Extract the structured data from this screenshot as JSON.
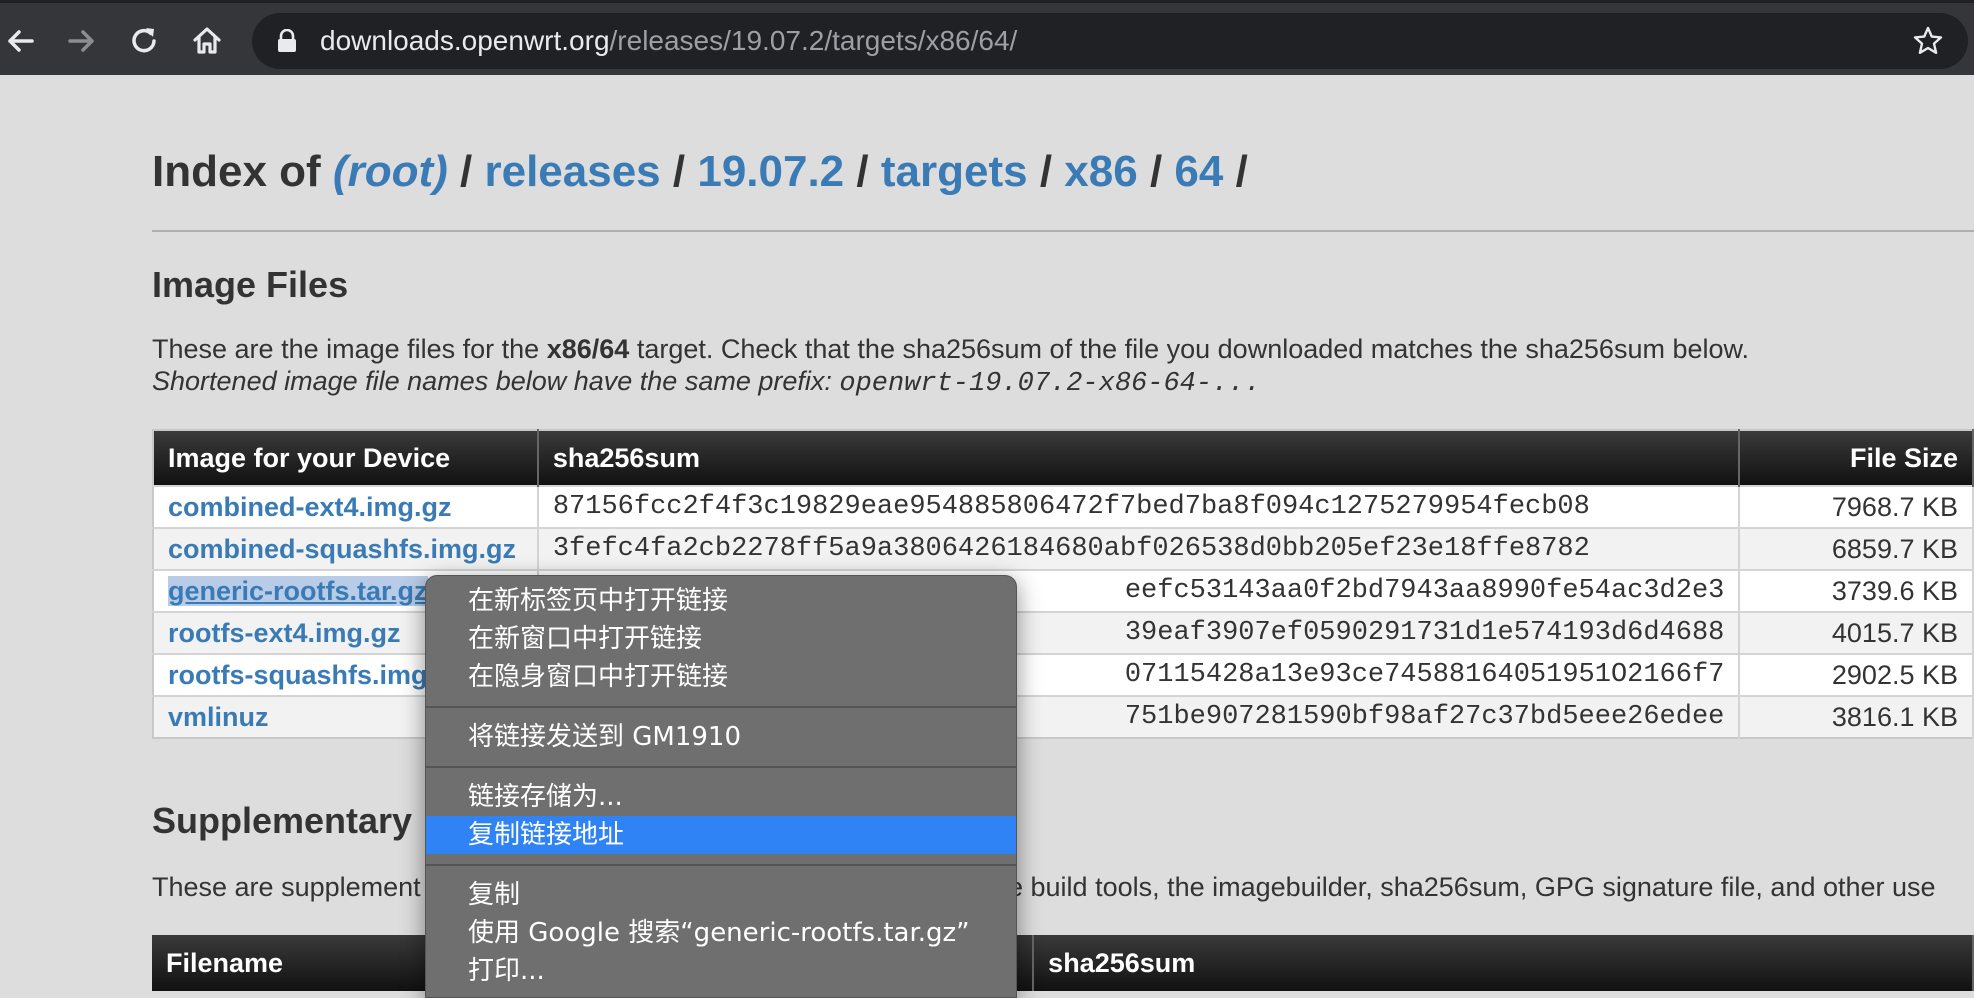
{
  "browser": {
    "url_host": "downloads.openwrt.org",
    "url_path": "/releases/19.07.2/targets/x86/64/"
  },
  "page": {
    "title_prefix": "Index of",
    "breadcrumb": [
      "(root)",
      "releases",
      "19.07.2",
      "targets",
      "x86",
      "64"
    ],
    "image_files_heading": "Image Files",
    "desc_line1_a": "These are the image files for the ",
    "desc_line1_target": "x86/64",
    "desc_line1_b": " target. Check that the sha256sum of the file you downloaded matches the sha256sum below.",
    "desc_line2_a": "Shortened image file names below have the same prefix: ",
    "desc_line2_prefix": "openwrt-19.07.2-x86-64-...",
    "table": {
      "headers": [
        "Image for your Device",
        "sha256sum",
        "File Size"
      ],
      "rows": [
        {
          "name": "combined-ext4.img.gz",
          "hash": "87156fcc2f4f3c19829eae954885806472f7bed7ba8f094c1275279954fecb08",
          "size": "7968.7 KB"
        },
        {
          "name": "combined-squashfs.img.gz",
          "hash": "3fefc4fa2cb2278ff5a9a3806426184680abf026538d0bb205ef23e18ffe8782",
          "size": "6859.7 KB"
        },
        {
          "name": "generic-rootfs.tar.gz",
          "hash": "eefc53143aa0f2bd7943aa8990fe54ac3d2e3",
          "size": "3739.6 KB"
        },
        {
          "name": "rootfs-ext4.img.gz",
          "hash": "39eaf3907ef0590291731d1e574193d6d4688",
          "size": "4015.7 KB"
        },
        {
          "name": "rootfs-squashfs.img",
          "hash": "07115428a13e93ce74588164051951O2166f7",
          "size": "2902.5 KB"
        },
        {
          "name": "vmlinuz",
          "hash": "751be907281590bf98af27c37bd5eee26edee",
          "size": "3816.1 KB"
        }
      ]
    },
    "supplementary_heading": "Supplementary",
    "supp_desc_a": "These are supplement",
    "supp_desc_b": "e build tools, the imagebuilder, sha256sum, GPG signature file, and other use",
    "supp_headers": [
      "Filename",
      "sha256sum"
    ]
  },
  "context_menu": {
    "items": [
      "在新标签页中打开链接",
      "在新窗口中打开链接",
      "在隐身窗口中打开链接",
      "将链接发送到 GM1910",
      "链接存储为...",
      "复制链接地址",
      "复制",
      "使用 Google 搜索“generic-rootfs.tar.gz”",
      "打印..."
    ],
    "active_index": 5
  }
}
